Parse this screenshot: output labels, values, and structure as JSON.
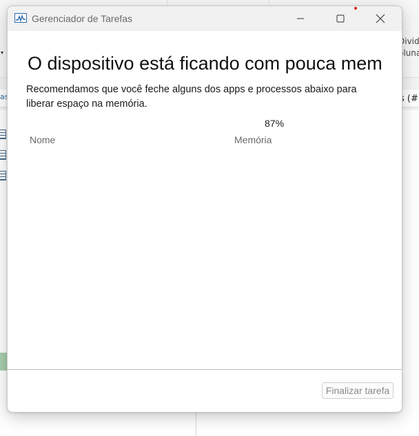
{
  "background_app": {
    "ribbon_right_line1": "Divid",
    "ribbon_right_line2": "oluna",
    "left_tag": "as",
    "right_tag": "s (#"
  },
  "window": {
    "title": "Gerenciador de Tarefas",
    "controls": {
      "minimize": "minimize-icon",
      "maximize": "maximize-icon",
      "close": "close-icon"
    }
  },
  "dialog": {
    "heading": "O dispositivo está ficando com pouca memória",
    "message": "Recomendamos que você feche alguns dos apps e processos abaixo para liberar espaço na memória.",
    "memory_usage_percent": "87%",
    "columns": {
      "name": "Nome",
      "memory": "Memória"
    },
    "rows": [],
    "end_task_label": "Finalizar tarefa"
  },
  "colors": {
    "titlebar": "#f1f1f1",
    "window_bg": "#ffffff",
    "disabled_text": "#8a8a8a",
    "notification_dot": "#dd2211"
  }
}
